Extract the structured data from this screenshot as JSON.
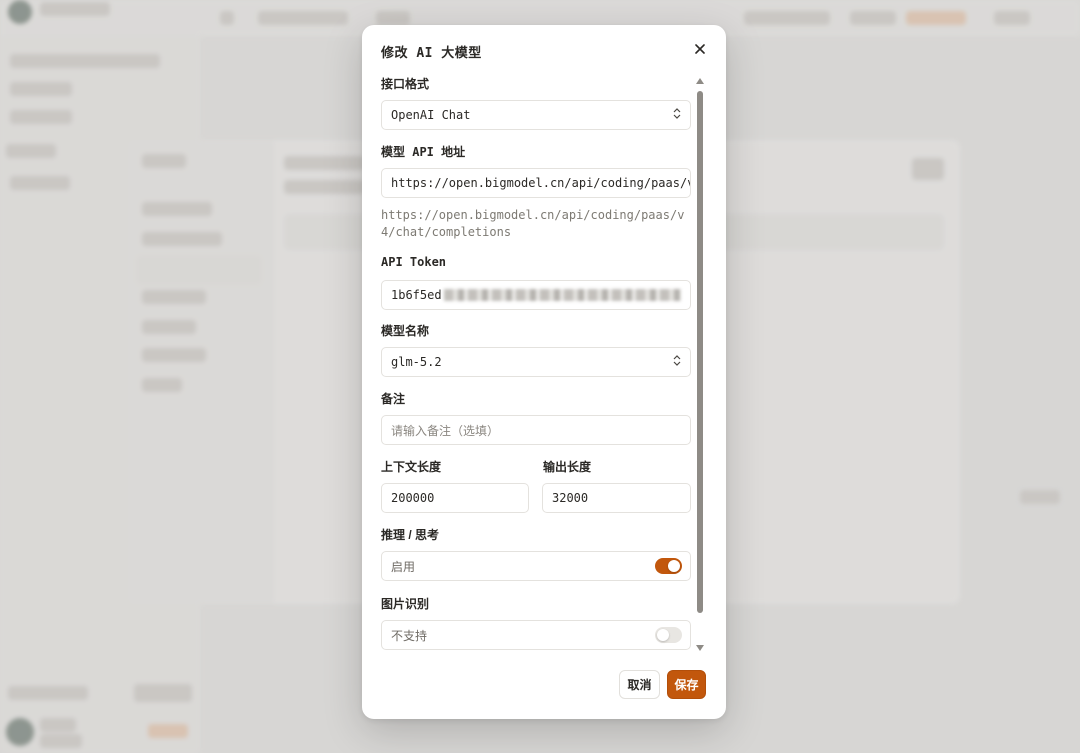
{
  "modal": {
    "title": "修改 AI 大模型",
    "close_icon": "close-icon",
    "fields": {
      "interface_format": {
        "label": "接口格式",
        "value": "OpenAI Chat"
      },
      "api_url": {
        "label": "模型 API 地址",
        "value": "https://open.bigmodel.cn/api/coding/paas/v4",
        "hint": "https://open.bigmodel.cn/api/coding/paas/v4/chat/completions"
      },
      "api_token": {
        "label": "API Token",
        "value_visible": "1b6f5ed"
      },
      "model_name": {
        "label": "模型名称",
        "value": "glm-5.2"
      },
      "note": {
        "label": "备注",
        "placeholder": "请输入备注（选填）"
      },
      "context_length": {
        "label": "上下文长度",
        "value": "200000"
      },
      "output_length": {
        "label": "输出长度",
        "value": "32000"
      },
      "reasoning": {
        "label": "推理 / 思考",
        "toggle_text": "启用",
        "enabled": true
      },
      "image_recognition": {
        "label": "图片识别",
        "toggle_text": "不支持",
        "enabled": false
      }
    },
    "buttons": {
      "cancel": "取消",
      "save": "保存"
    },
    "accent_color": "#c2570c"
  }
}
